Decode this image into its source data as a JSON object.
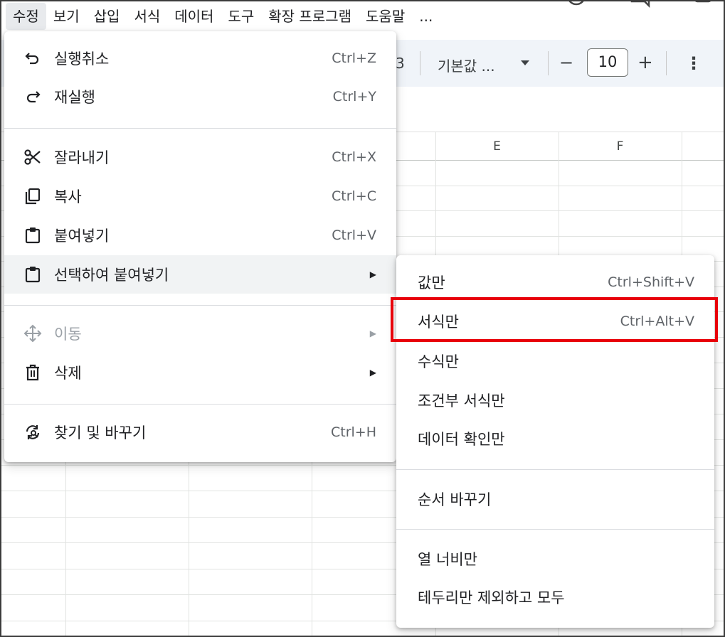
{
  "menubar": {
    "items": [
      "수정",
      "보기",
      "삽입",
      "서식",
      "데이터",
      "도구",
      "확장 프로그램",
      "도움말",
      "..."
    ]
  },
  "toolbar": {
    "partial_text": "3",
    "font_name": "기본값 ...",
    "minus": "−",
    "font_size": "10",
    "plus": "+",
    "more": "⋮"
  },
  "grid": {
    "columns": [
      "E",
      "F"
    ]
  },
  "edit_menu": {
    "undo": {
      "label": "실행취소",
      "shortcut": "Ctrl+Z"
    },
    "redo": {
      "label": "재실행",
      "shortcut": "Ctrl+Y"
    },
    "cut": {
      "label": "잘라내기",
      "shortcut": "Ctrl+X"
    },
    "copy": {
      "label": "복사",
      "shortcut": "Ctrl+C"
    },
    "paste": {
      "label": "붙여넣기",
      "shortcut": "Ctrl+V"
    },
    "paste_special": {
      "label": "선택하여 붙여넣기",
      "arrow": "▶"
    },
    "move": {
      "label": "이동",
      "arrow": "▶"
    },
    "delete": {
      "label": "삭제",
      "arrow": "▶"
    },
    "find_replace": {
      "label": "찾기 및 바꾸기",
      "shortcut": "Ctrl+H"
    }
  },
  "paste_special_menu": {
    "values_only": {
      "label": "값만",
      "shortcut": "Ctrl+Shift+V"
    },
    "format_only": {
      "label": "서식만",
      "shortcut": "Ctrl+Alt+V"
    },
    "formula_only": {
      "label": "수식만"
    },
    "conditional_format_only": {
      "label": "조건부 서식만"
    },
    "data_validation_only": {
      "label": "데이터 확인만"
    },
    "transpose": {
      "label": "순서 바꾸기"
    },
    "column_width_only": {
      "label": "열 너비만"
    },
    "all_except_borders": {
      "label": "테두리만 제외하고 모두"
    }
  },
  "colors": {
    "highlight": "#e8000a",
    "hover": "#f1f3f4"
  }
}
